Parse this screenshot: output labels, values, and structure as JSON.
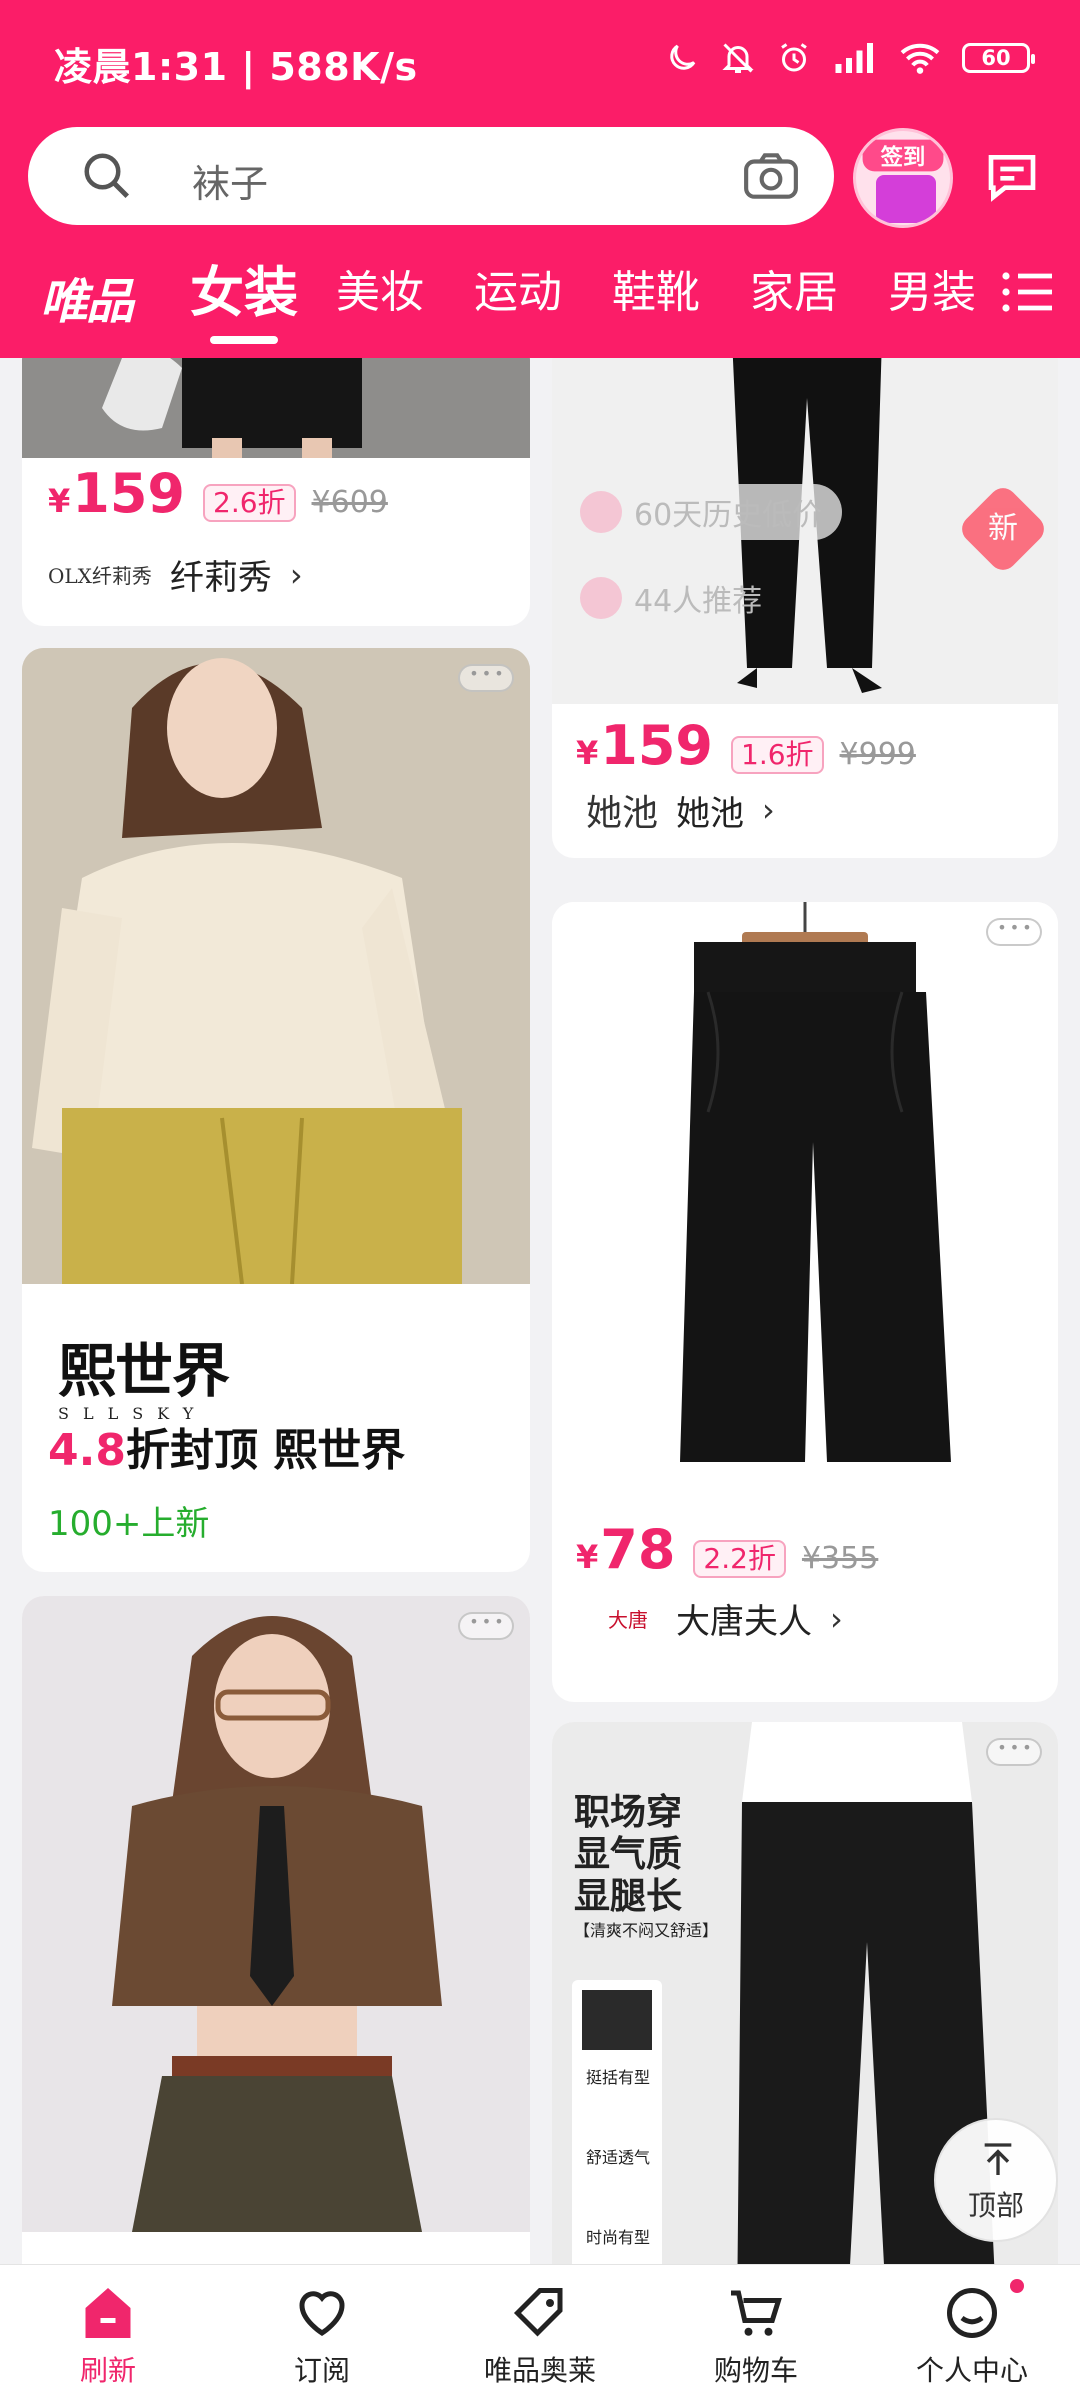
{
  "status_bar": {
    "time_speed": "凌晨1:31 | 588K/s",
    "battery": "60"
  },
  "search": {
    "placeholder": "袜子"
  },
  "checkin": {
    "label": "签到"
  },
  "tabs": {
    "logo": "唯品",
    "items": [
      "女装",
      "美妆",
      "运动",
      "鞋靴",
      "家居",
      "男装"
    ],
    "active": "女装"
  },
  "products": [
    {
      "price_symbol": "¥",
      "price": "159",
      "discount": "2.6折",
      "original": "¥609",
      "brand_mark": "OLX纤莉秀",
      "brand": "纤莉秀",
      "chevron": "›"
    },
    {
      "price_symbol": "¥",
      "price": "159",
      "discount": "1.6折",
      "original": "¥999",
      "brand_mark": "她池",
      "brand": "她池",
      "chevron": "›",
      "overlay_history": "60天历史低价",
      "overlay_recommend": "44人推荐",
      "new_badge": "新"
    },
    {
      "price_symbol": "¥",
      "price": "78",
      "discount": "2.2折",
      "original": "¥355",
      "brand_mark": "大唐",
      "brand": "大唐夫人",
      "chevron": "›"
    }
  ],
  "brand_card": {
    "logo_big": "熙世界",
    "logo_small": "SLLSKY",
    "title_num": "4.8",
    "title_rest": "折封顶 熙世界",
    "new_count": "100+上新"
  },
  "promo_image": {
    "line1": "职场穿",
    "line2": "显气质",
    "line3": "显腿长",
    "sub": "【清爽不闷又舒适】",
    "feat1": "挺括有型",
    "feat2": "舒适透气",
    "feat3": "时尚有型"
  },
  "back_top": {
    "label": "顶部"
  },
  "bottom_nav": {
    "items": [
      {
        "label": "刷新",
        "icon": "home-icon"
      },
      {
        "label": "订阅",
        "icon": "heart-icon"
      },
      {
        "label": "唯品奥莱",
        "icon": "tag-icon"
      },
      {
        "label": "购物车",
        "icon": "cart-icon"
      },
      {
        "label": "个人中心",
        "icon": "profile-icon"
      }
    ]
  },
  "colors": {
    "brand_pink": "#fb1d68",
    "price_pink": "#f0266c",
    "new_green": "#26ad2e"
  }
}
